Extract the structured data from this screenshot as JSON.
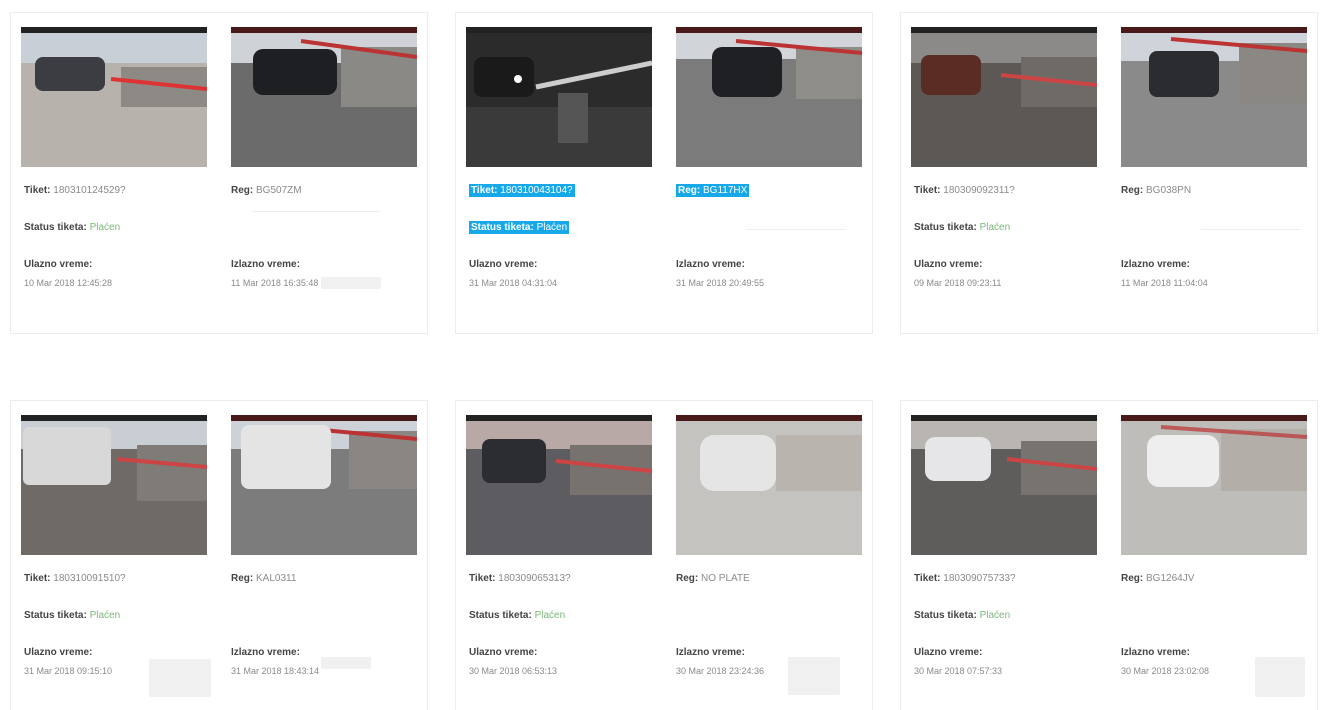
{
  "labels": {
    "ticket": "Tiket:",
    "reg": "Reg:",
    "status": "Status tiketa:",
    "entry": "Ulazno vreme:",
    "exit": "Izlazno vreme:"
  },
  "colors": {
    "highlight": "#16a8e8",
    "status_paid": "#7ab87a",
    "card_border": "#ececec"
  },
  "cards": [
    {
      "ticket": "180310124529?",
      "reg": "BG507ZM",
      "status": "Plaćen",
      "entry": "10 Mar 2018 12:45:28",
      "exit": "11 Mar 2018 16:35:48"
    },
    {
      "ticket": "180310043104?",
      "reg": "BG117HX",
      "status": "Plaćen",
      "entry": "31 Mar 2018 04:31:04",
      "exit": "31 Mar 2018 20:49:55"
    },
    {
      "ticket": "180309092311?",
      "reg": "BG038PN",
      "status": "Plaćen",
      "entry": "09 Mar 2018 09:23:11",
      "exit": "11 Mar 2018 11:04:04"
    },
    {
      "ticket": "180310091510?",
      "reg": "KAL0311",
      "status": "Plaćen",
      "entry": "31 Mar 2018 09:15:10",
      "exit": "31 Mar 2018 18:43:14"
    },
    {
      "ticket": "180309065313?",
      "reg": "NO PLATE",
      "status": "Plaćen",
      "entry": "30 Mar 2018 06:53:13",
      "exit": "30 Mar 2018 23:24:36"
    },
    {
      "ticket": "180309075733?",
      "reg": "BG1264JV",
      "status": "Plaćen",
      "entry": "30 Mar 2018 07:57:33",
      "exit": "30 Mar 2018 23:02:08"
    }
  ]
}
